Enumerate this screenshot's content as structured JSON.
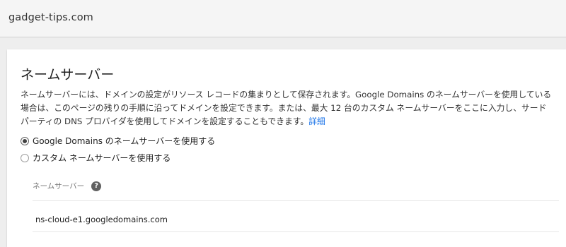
{
  "header": {
    "domain": "gadget-tips.com"
  },
  "card": {
    "title": "ネームサーバー",
    "description": "ネームサーバーには、ドメインの設定がリソース レコードの集まりとして保存されます。Google Domains のネームサーバーを使用している場合は、このページの残りの手順に沿ってドメインを設定できます。または、最大 12 台のカスタム ネームサーバーをここに入力し、サードパーティの DNS プロバイダを使用してドメインを設定することもできます。",
    "link_label": "詳細",
    "options": [
      {
        "label": "Google Domains のネームサーバーを使用する",
        "selected": true
      },
      {
        "label": "カスタム ネームサーバーを使用する",
        "selected": false
      }
    ],
    "nameservers": {
      "header": "ネームサーバー",
      "help_icon": "help-icon",
      "values": [
        "ns-cloud-e1.googledomains.com"
      ]
    }
  }
}
